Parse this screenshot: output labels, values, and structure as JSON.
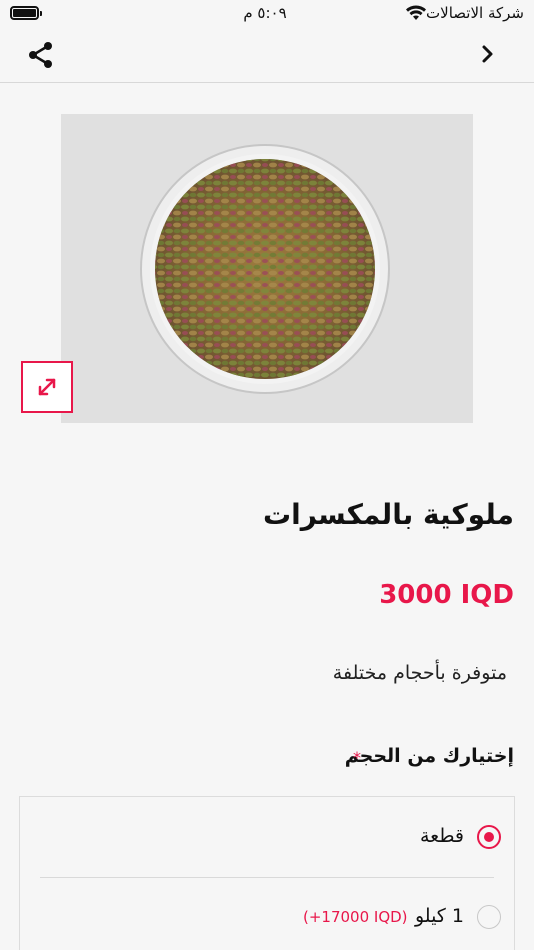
{
  "status_bar": {
    "carrier": "شركة الاتصالات",
    "time": "٥:٠٩ م"
  },
  "nav": {
    "share_icon": "share-icon",
    "back_icon": "chevron-right-icon"
  },
  "product": {
    "image_alt": "pistachio bowl",
    "title": "ملوكية بالمكسرات",
    "price": "3000 IQD",
    "description": "متوفرة بأحجام مختلفة"
  },
  "size_selector": {
    "heading": "إختيارك من الحجم",
    "required_mark": "*",
    "options": [
      {
        "label": "قطعة",
        "extra": "",
        "selected": true
      },
      {
        "label": "1 كيلو",
        "extra": "(+17000 IQD)",
        "selected": false
      }
    ]
  },
  "colors": {
    "accent": "#e8174a",
    "background": "#f6f6f6"
  }
}
